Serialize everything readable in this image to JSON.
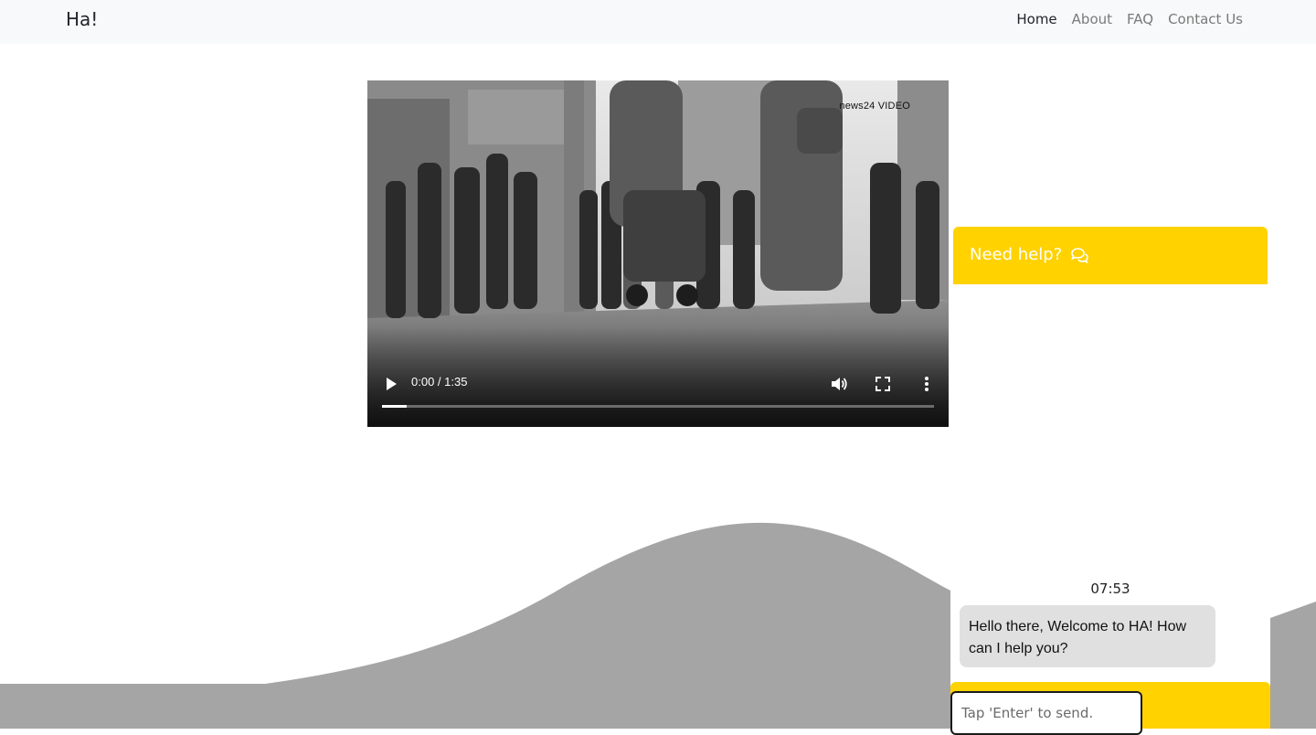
{
  "navbar": {
    "brand": "Ha!",
    "links": [
      {
        "label": "Home",
        "active": true
      },
      {
        "label": "About",
        "active": false
      },
      {
        "label": "FAQ",
        "active": false
      },
      {
        "label": "Contact Us",
        "active": false
      }
    ]
  },
  "video": {
    "watermark": "news24 VIDEO",
    "time": "0:00 / 1:35",
    "progress": 0.045
  },
  "chat": {
    "help_label": "Need help?",
    "help_icon": "comments-icon",
    "timestamp": "07:53",
    "message": "Hello there, Welcome to HA! How can I help you?",
    "input_placeholder": "Tap 'Enter' to send."
  },
  "colors": {
    "accent": "#ffd200",
    "wave": "#a5a5a5",
    "navbar_bg": "#f8f9fa",
    "bubble_bg": "#e0e0e0"
  }
}
